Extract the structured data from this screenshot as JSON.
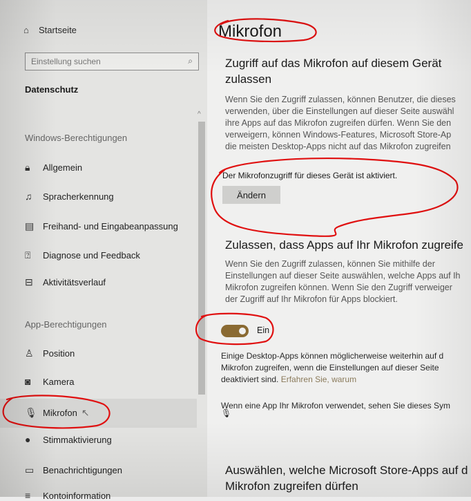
{
  "sidebar": {
    "home_label": "Startseite",
    "search_placeholder": "Einstellung suchen",
    "category_title": "Datenschutz",
    "windows_section": "Windows-Berechtigungen",
    "windows_items": [
      {
        "label": "Allgemein",
        "icon": "lock-icon"
      },
      {
        "label": "Spracherkennung",
        "icon": "speech-icon"
      },
      {
        "label": "Freihand- und Eingabeanpassung",
        "icon": "notepad-icon"
      },
      {
        "label": "Diagnose und Feedback",
        "icon": "feedback-icon"
      },
      {
        "label": "Aktivitätsverlauf",
        "icon": "timeline-icon"
      }
    ],
    "app_section": "App-Berechtigungen",
    "app_items": [
      {
        "label": "Position",
        "icon": "location-icon"
      },
      {
        "label": "Kamera",
        "icon": "camera-icon"
      },
      {
        "label": "Mikrofon",
        "icon": "microphone-icon",
        "selected": true
      },
      {
        "label": "Stimmaktivierung",
        "icon": "voice-icon"
      },
      {
        "label": "Benachrichtigungen",
        "icon": "notification-icon"
      },
      {
        "label": "Kontoinformation",
        "icon": "account-icon"
      }
    ]
  },
  "main": {
    "title": "Mikrofon",
    "device_access": {
      "heading_line1": "Zugriff auf das Mikrofon auf diesem Gerät",
      "heading_line2": "zulassen",
      "desc_lines": [
        "Wenn Sie den Zugriff zulassen, können Benutzer, die dieses",
        "verwenden, über die Einstellungen auf dieser Seite auswähl",
        "ihre Apps auf das Mikrofon zugreifen dürfen. Wenn Sie den",
        "verweigern, können Windows-Features, Microsoft Store-Ap",
        "die meisten Desktop-Apps nicht auf das Mikrofon zugreifen"
      ],
      "status": "Der Mikrofonzugriff für dieses Gerät ist aktiviert.",
      "button_label": "Ändern"
    },
    "app_access": {
      "heading": "Zulassen, dass Apps auf Ihr Mikrofon zugreife",
      "desc_lines": [
        "Wenn Sie den Zugriff zulassen, können Sie mithilfe der",
        "Einstellungen auf dieser Seite auswählen, welche Apps auf Ih",
        "Mikrofon zugreifen können. Wenn Sie den Zugriff verweiger",
        "der Zugriff auf Ihr Mikrofon für Apps blockiert."
      ],
      "toggle_state": "Ein",
      "toggle_on": true,
      "toggle_color": "#8a6a32",
      "note_lines": [
        "Einige Desktop-Apps können möglicherweise weiterhin auf d",
        "Mikrofon zugreifen, wenn die Einstellungen auf dieser Seite"
      ],
      "note_line3": "deaktiviert sind.",
      "learn_more": "Erfahren Sie, warum",
      "usage_note": "Wenn eine App Ihr Mikrofon verwendet, sehen Sie dieses Sym"
    },
    "store_apps": {
      "heading_line1": "Auswählen, welche Microsoft Store-Apps auf d",
      "heading_line2": "Mikrofon zugreifen dürfen"
    }
  },
  "colors": {
    "annotation": "#e01010",
    "accent": "#8a6a32"
  }
}
